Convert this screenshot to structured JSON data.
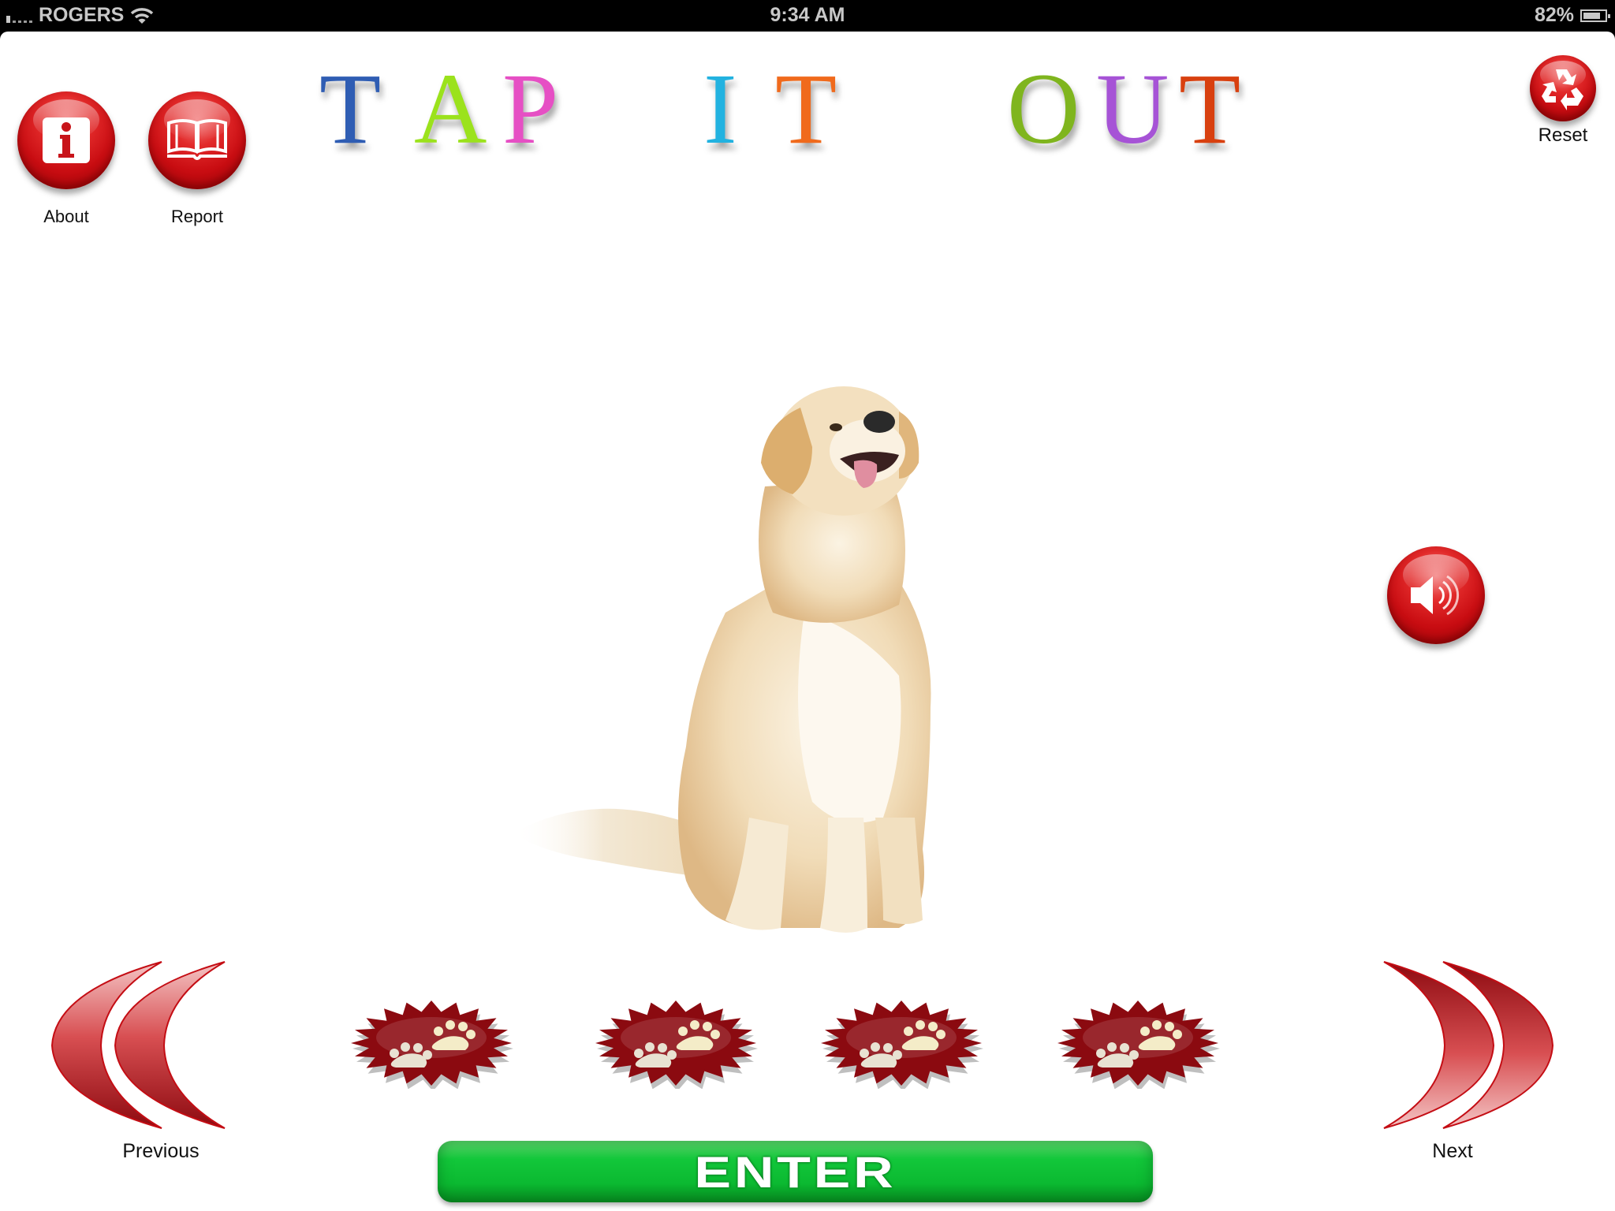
{
  "status_bar": {
    "carrier": "ROGERS",
    "signal_bars": 1,
    "signal_max": 5,
    "wifi": true,
    "time": "9:34 AM",
    "battery_label": "82%",
    "battery_level": 0.82
  },
  "title": {
    "letters": [
      {
        "char": "T",
        "color": "#2f5db3"
      },
      {
        "char": "A",
        "color": "#9be21c"
      },
      {
        "char": "P",
        "color": "#e64fc4"
      },
      {
        "char": "I",
        "color": "#22b2e0"
      },
      {
        "char": "T",
        "color": "#f06a1c"
      },
      {
        "char": "O",
        "color": "#7fb51e"
      },
      {
        "char": "U",
        "color": "#a653d6"
      },
      {
        "char": "T",
        "color": "#d8400f"
      }
    ],
    "text": "TAP IT OUT"
  },
  "buttons": {
    "about": {
      "label": "About",
      "icon": "info-icon"
    },
    "report": {
      "label": "Report",
      "icon": "book-icon"
    },
    "reset": {
      "label": "Reset",
      "icon": "recycle-icon"
    },
    "speaker": {
      "icon": "speaker-icon"
    },
    "previous": {
      "label": "Previous",
      "icon": "double-chevron-left-icon"
    },
    "next": {
      "label": "Next",
      "icon": "double-chevron-right-icon"
    },
    "enter": {
      "label": "ENTER"
    }
  },
  "picture": {
    "subject": "dog",
    "description": "golden retriever sitting"
  },
  "paw_badges": [
    {
      "icon": "paw-badge-icon"
    },
    {
      "icon": "paw-badge-icon"
    },
    {
      "icon": "paw-badge-icon"
    },
    {
      "icon": "paw-badge-icon"
    }
  ],
  "colors": {
    "button_red": "#c90d12",
    "badge_red": "#8b0a10",
    "enter_green": "#12c73a",
    "paw_cream": "#f4ecc8"
  }
}
